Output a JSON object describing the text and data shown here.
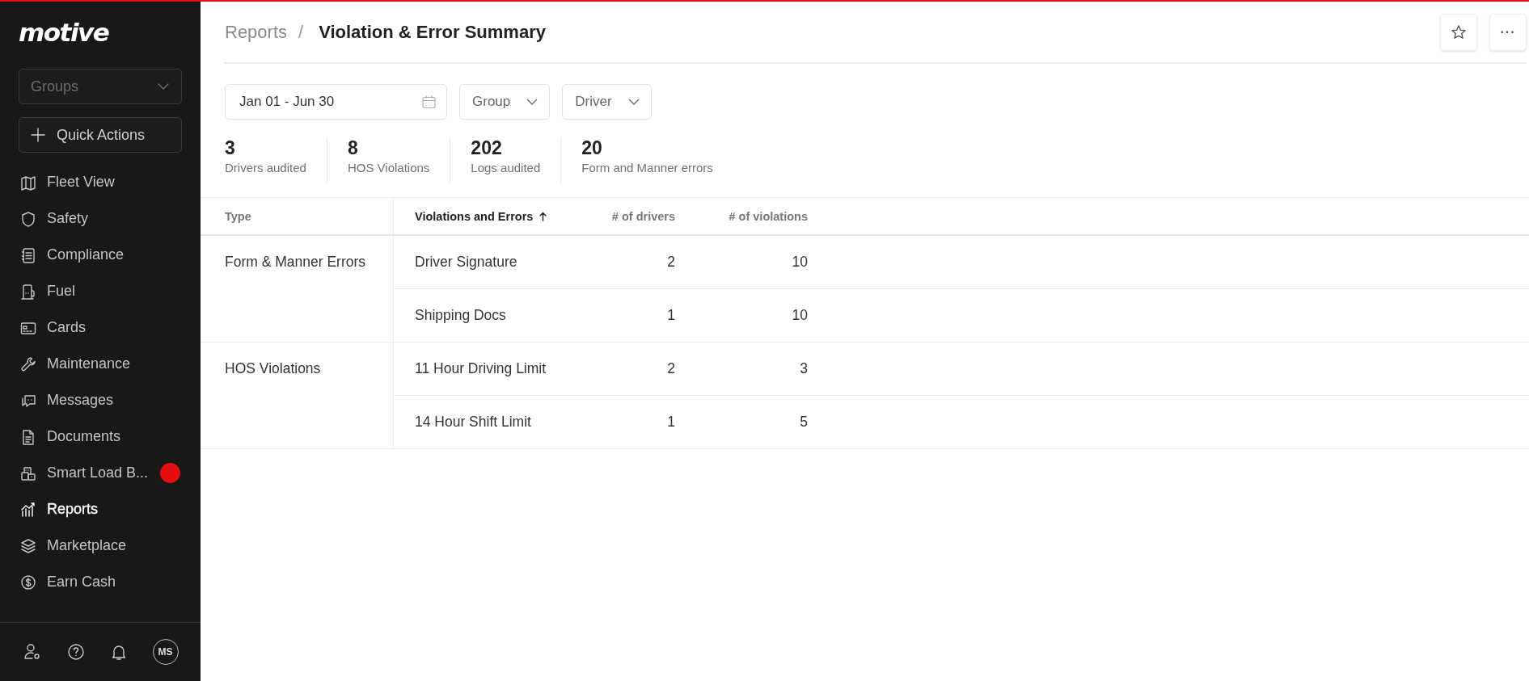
{
  "sidebar": {
    "logo": "motive",
    "groups_dropdown": {
      "placeholder": "Groups"
    },
    "quick_actions": "Quick Actions",
    "items": [
      {
        "label": "Fleet View",
        "selected": false,
        "dot": false
      },
      {
        "label": "Safety",
        "selected": false,
        "dot": false
      },
      {
        "label": "Compliance",
        "selected": false,
        "dot": false
      },
      {
        "label": "Fuel",
        "selected": false,
        "dot": false
      },
      {
        "label": "Cards",
        "selected": false,
        "dot": false
      },
      {
        "label": "Maintenance",
        "selected": false,
        "dot": false
      },
      {
        "label": "Messages",
        "selected": false,
        "dot": false
      },
      {
        "label": "Documents",
        "selected": false,
        "dot": false
      },
      {
        "label": "Smart Load B...",
        "selected": false,
        "dot": true
      },
      {
        "label": "Reports",
        "selected": true,
        "dot": false
      },
      {
        "label": "Marketplace",
        "selected": false,
        "dot": false
      },
      {
        "label": "Earn Cash",
        "selected": false,
        "dot": false
      }
    ],
    "avatar": "MS"
  },
  "header": {
    "breadcrumb": [
      "Reports",
      "Violation & Error Summary"
    ],
    "separator": "/",
    "more_button": "···"
  },
  "filters": {
    "date_range": "Jan 01 - Jun 30",
    "dropdowns": [
      "Group",
      "Driver"
    ]
  },
  "stats": [
    {
      "value": "3",
      "label": "Drivers audited"
    },
    {
      "value": "8",
      "label": "HOS Violations"
    },
    {
      "value": "202",
      "label": "Logs audited"
    },
    {
      "value": "20",
      "label": "Form and Manner errors"
    }
  ],
  "table": {
    "columns": [
      {
        "label": "Type",
        "sorted": false
      },
      {
        "label": "Violations and Errors",
        "sorted": true
      },
      {
        "label": "# of drivers",
        "sorted": false
      },
      {
        "label": "# of violations",
        "sorted": false
      }
    ],
    "groups": [
      {
        "type": "Form & Manner Errors",
        "rows": [
          {
            "name": "Driver Signature",
            "drivers": "2",
            "violations": "10"
          },
          {
            "name": "Shipping Docs",
            "drivers": "1",
            "violations": "10"
          }
        ]
      },
      {
        "type": "HOS Violations",
        "rows": [
          {
            "name": "11 Hour Driving Limit",
            "drivers": "2",
            "violations": "3"
          },
          {
            "name": "14 Hour Shift Limit",
            "drivers": "1",
            "violations": "5"
          }
        ]
      }
    ]
  }
}
